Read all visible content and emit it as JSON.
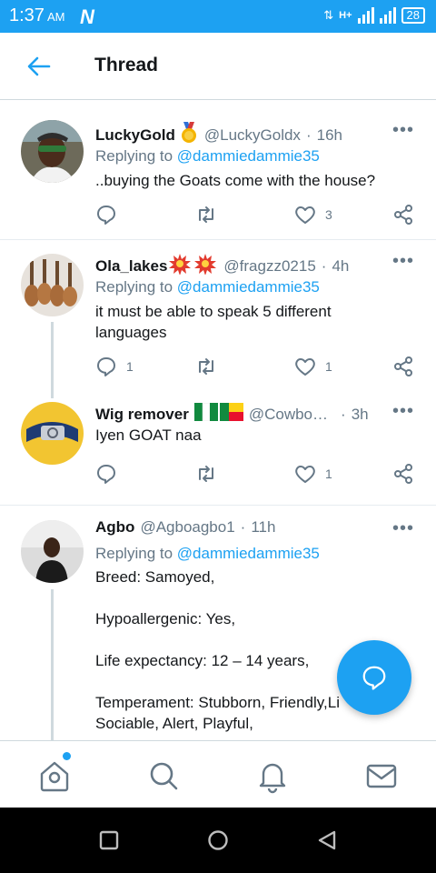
{
  "status_bar": {
    "time": "1:37",
    "ampm": "AM",
    "network": "H+",
    "battery": "28"
  },
  "header": {
    "title": "Thread"
  },
  "tweets": [
    {
      "name": "LuckyGold",
      "badge": "🏅",
      "handle": "@LuckyGoldx",
      "time": "16h",
      "replying_label": "Replying to",
      "replying_to": "@dammiedammie35",
      "text": "..buying the Goats come with the house?",
      "reply_count": "",
      "like_count": "3"
    },
    {
      "name": "Ola_lakes",
      "badge": "💥💥",
      "handle": "@fragzz0215",
      "time": "4h",
      "replying_label": "Replying to",
      "replying_to": "@dammiedammie35",
      "text": "it must be able to speak 5 different languages",
      "reply_count": "1",
      "like_count": "1"
    },
    {
      "name": "Wig remover",
      "badge": "",
      "handle": "@Cowbo…",
      "time": "3h",
      "text": "Iyen GOAT naa",
      "reply_count": "",
      "like_count": "1"
    },
    {
      "name": "Agbo",
      "handle": "@Agboagbo1",
      "time": "11h",
      "replying_label": "Replying to",
      "replying_to": "@dammiedammie35",
      "lines": [
        "Breed: Samoyed,",
        "Hypoallergenic: Yes,",
        "Life expectancy: 12 – 14 years,",
        "Temperament: Stubborn, Friendly,Li",
        "Sociable, Alert, Playful,"
      ]
    }
  ],
  "icons": {
    "back": "arrow-left-icon",
    "more": "more-horizontal-icon",
    "reply": "reply-icon",
    "retweet": "retweet-icon",
    "like": "heart-icon",
    "share": "share-icon",
    "compose": "compose-reply-icon",
    "home": "home-icon",
    "search": "search-icon",
    "notifications": "bell-icon",
    "messages": "mail-icon"
  },
  "colors": {
    "accent": "#1da1f2",
    "text": "#14171a",
    "muted": "#657786",
    "divider": "#e6ecf0"
  }
}
